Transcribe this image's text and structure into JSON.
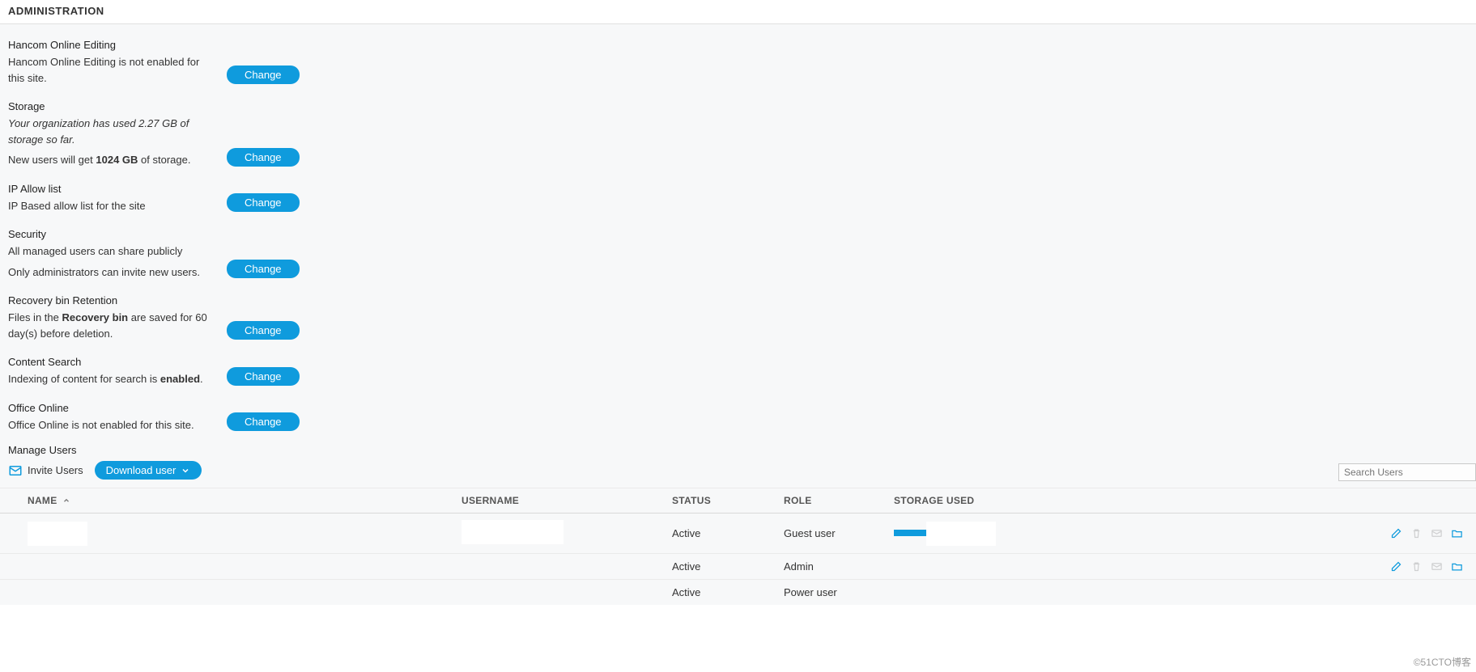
{
  "header": {
    "title": "ADMINISTRATION"
  },
  "settings": {
    "hancom": {
      "title": "Hancom Online Editing",
      "desc": "Hancom Online Editing is not enabled for this site.",
      "button": "Change"
    },
    "storage": {
      "title": "Storage",
      "desc1_prefix": "Your organization has used ",
      "desc1_value": "2.27 GB",
      "desc1_suffix": " of storage so far.",
      "desc2_prefix": "New users will get ",
      "desc2_value": "1024 GB",
      "desc2_suffix": " of storage.",
      "button": "Change"
    },
    "ipallow": {
      "title": "IP Allow list",
      "desc": "IP Based allow list for the site",
      "button": "Change"
    },
    "security": {
      "title": "Security",
      "desc1": "All managed users can share publicly",
      "desc2": "Only administrators can invite new users.",
      "button": "Change"
    },
    "recovery": {
      "title": "Recovery bin Retention",
      "desc_prefix": "Files in the ",
      "desc_bold": "Recovery bin",
      "desc_suffix": " are saved for 60 day(s) before deletion.",
      "button": "Change"
    },
    "contentsearch": {
      "title": "Content Search",
      "desc_prefix": "Indexing of content for search is ",
      "desc_bold": "enabled",
      "desc_suffix": ".",
      "button": "Change"
    },
    "officeonline": {
      "title": "Office Online",
      "desc": "Office Online is not enabled for this site.",
      "button": "Change"
    }
  },
  "manage": {
    "title": "Manage Users",
    "invite_label": "Invite Users",
    "download_label": "Download user",
    "search_placeholder": "Search Users"
  },
  "table": {
    "headers": {
      "name": "NAME",
      "username": "USERNAME",
      "status": "STATUS",
      "role": "ROLE",
      "storage": "STORAGE USED"
    },
    "rows": [
      {
        "name": "",
        "username": "",
        "status": "Active",
        "role": "Guest user",
        "storage_bar": true
      },
      {
        "name": "",
        "username": "",
        "status": "Active",
        "role": "Admin",
        "storage_bar": false
      },
      {
        "name": "",
        "username": "",
        "status": "Active",
        "role": "Power user",
        "storage_bar": false
      }
    ]
  },
  "watermark": "©51CTO博客"
}
